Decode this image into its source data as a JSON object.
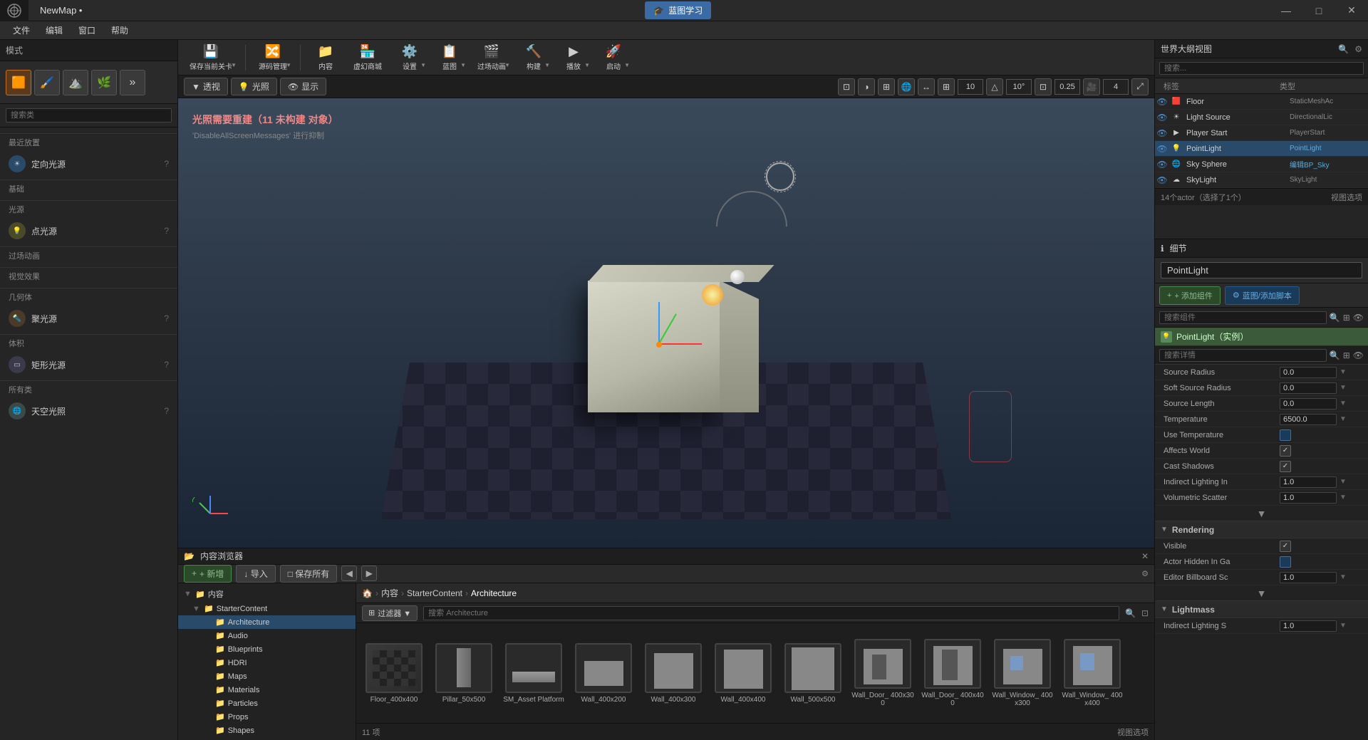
{
  "titlebar": {
    "title": "NewMap •",
    "blueprint_label": "蓝图学习",
    "min_btn": "—",
    "max_btn": "□",
    "close_btn": "✕"
  },
  "menubar": {
    "items": [
      "文件",
      "编辑",
      "窗口",
      "帮助"
    ]
  },
  "modes": {
    "label": "模式"
  },
  "left_panel": {
    "search_placeholder": "搜索类",
    "recent_label": "最近放置",
    "basic_label": "基础",
    "lights_label": "光源",
    "cinematic_label": "过场动画",
    "visual_label": "视觉效果",
    "geometry_label": "几何体",
    "volumes_label": "体积",
    "all_label": "所有类",
    "lights": [
      {
        "label": "定向光源"
      },
      {
        "label": "点光源"
      },
      {
        "label": "聚光源"
      },
      {
        "label": "矩形光源"
      },
      {
        "label": "天空光照"
      }
    ]
  },
  "toolbar": {
    "buttons": [
      {
        "label": "保存当前关卡"
      },
      {
        "label": "源码管理"
      },
      {
        "label": "内容"
      },
      {
        "label": "虚幻商城"
      },
      {
        "label": "设置"
      },
      {
        "label": "蓝图"
      },
      {
        "label": "过场动画"
      },
      {
        "label": "构建"
      },
      {
        "label": "播放"
      },
      {
        "label": "启动"
      }
    ]
  },
  "viewport": {
    "view_mode": "透视",
    "lighting_mode": "光照",
    "show_mode": "显示",
    "grid_size": "10",
    "rotation_snap": "10°",
    "scale_snap": "0.25",
    "camera_speed": "4",
    "warning_text": "光照需要重建（11 未构建 对象）",
    "hint_text": "'DisableAllScreenMessages' 进行抑制"
  },
  "content_browser": {
    "title": "内容浏览器",
    "new_btn": "+ 新增",
    "import_btn": "↓ 导入",
    "save_btn": "□ 保存所有",
    "breadcrumb": [
      "内容",
      "StarterContent",
      "Architecture"
    ],
    "filter_placeholder": "搜索 Architecture",
    "status": "11 项",
    "view_options": "视图选项",
    "assets": [
      {
        "label": "Floor_400x400",
        "color": "#3a3a3a"
      },
      {
        "label": "Pillar_50x500",
        "color": "#4a4a4a"
      },
      {
        "label": "SM_Asset Platform",
        "color": "#404040"
      },
      {
        "label": "Wall_400x200",
        "color": "#383838"
      },
      {
        "label": "Wall_400x300",
        "color": "#3e3e3e"
      },
      {
        "label": "Wall_400x400",
        "color": "#3a3a3a"
      },
      {
        "label": "Wall_500x500",
        "color": "#404040"
      },
      {
        "label": "Wall_Door_ 400x300",
        "color": "#3d3d3d"
      },
      {
        "label": "Wall_Door_ 400x400",
        "color": "#3a3a3a"
      },
      {
        "label": "Wall_Window_ 400x300",
        "color": "#404040"
      },
      {
        "label": "Wall_Window_ 400x400",
        "color": "#3a3a3a"
      }
    ]
  },
  "tree": {
    "items": [
      {
        "label": "内容",
        "level": 0,
        "expanded": true
      },
      {
        "label": "StarterContent",
        "level": 1,
        "expanded": true
      },
      {
        "label": "Architecture",
        "level": 2,
        "selected": true
      },
      {
        "label": "Audio",
        "level": 2
      },
      {
        "label": "Blueprints",
        "level": 2
      },
      {
        "label": "HDRI",
        "level": 2
      },
      {
        "label": "Maps",
        "level": 2
      },
      {
        "label": "Materials",
        "level": 2
      },
      {
        "label": "Particles",
        "level": 2
      },
      {
        "label": "Props",
        "level": 2
      },
      {
        "label": "Shapes",
        "level": 2
      }
    ]
  },
  "outliner": {
    "title": "世界大纲视图",
    "col_label": "标签",
    "col_type": "类型",
    "actors": [
      {
        "name": "Floor",
        "type": "StaticMeshAc"
      },
      {
        "name": "Light Source",
        "type": "DirectionalLic"
      },
      {
        "name": "Player Start",
        "type": "PlayerStart"
      },
      {
        "name": "PointLight",
        "type": "PointLight",
        "selected": true
      },
      {
        "name": "Sky Sphere",
        "type": "编辑BP_Sky"
      },
      {
        "name": "SkyLight",
        "type": "SkyLight"
      }
    ],
    "footer": "14个actor（选择了1个）",
    "view_options": "视图选项"
  },
  "details": {
    "title": "细节",
    "component_name": "PointLight（实例）",
    "name_value": "PointLight",
    "add_component_btn": "+ 添加组件",
    "blueprint_btn": "蓝图/添加脚本",
    "search_component_placeholder": "搜索组件",
    "search_details_placeholder": "搜索详情",
    "properties": {
      "source_radius_label": "Source Radius",
      "source_radius_value": "0.0",
      "soft_source_radius_label": "Soft Source Radius",
      "soft_source_radius_value": "0.0",
      "source_length_label": "Source Length",
      "source_length_value": "0.0",
      "temperature_label": "Temperature",
      "temperature_value": "6500.0",
      "use_temperature_label": "Use Temperature",
      "affects_world_label": "Affects World",
      "cast_shadows_label": "Cast Shadows",
      "indirect_lighting_label": "Indirect Lighting In",
      "indirect_lighting_value": "1.0",
      "volumetric_scatter_label": "Volumetric Scatter",
      "volumetric_scatter_value": "1.0"
    },
    "rendering_section": "Rendering",
    "rendering_props": {
      "visible_label": "Visible",
      "actor_hidden_label": "Actor Hidden In Ga",
      "editor_billboard_label": "Editor Billboard Sc",
      "editor_billboard_value": "1.0"
    },
    "lightmass_section": "Lightmass",
    "indirect_lighting_scale_label": "Indirect Lighting S",
    "indirect_lighting_scale_value": "1.0"
  }
}
